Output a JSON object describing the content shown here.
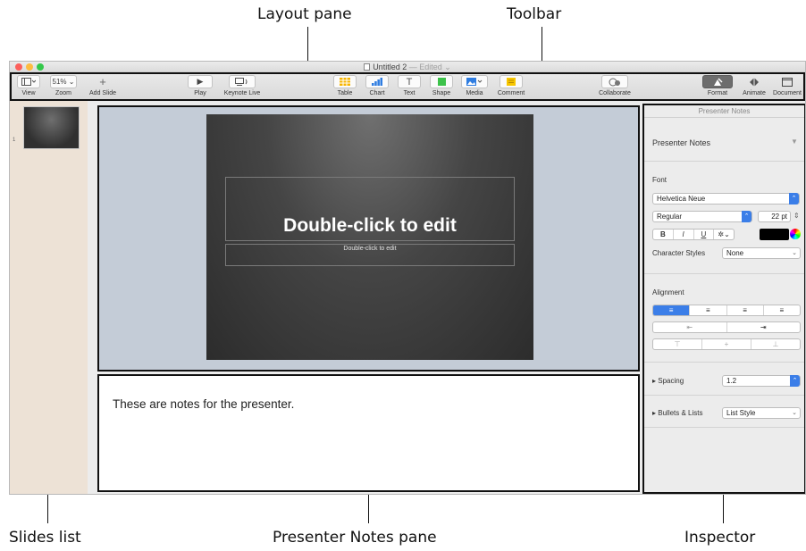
{
  "callouts": {
    "layout_pane": "Layout pane",
    "toolbar": "Toolbar",
    "slides_list": "Slides list",
    "presenter_notes_pane": "Presenter Notes pane",
    "inspector": "Inspector"
  },
  "window": {
    "title": "Untitled 2",
    "edited": "— Edited ⌄"
  },
  "toolbar": {
    "view": {
      "label": "View",
      "icon": "sidebar-view-icon"
    },
    "zoom": {
      "label": "Zoom",
      "value": "51% ⌄"
    },
    "add_slide": {
      "label": "Add Slide",
      "icon": "plus-icon"
    },
    "play": {
      "label": "Play",
      "icon": "play-icon"
    },
    "keynote_live": {
      "label": "Keynote Live",
      "icon": "keynote-live-icon"
    },
    "table": {
      "label": "Table",
      "icon": "table-icon"
    },
    "chart": {
      "label": "Chart",
      "icon": "chart-icon"
    },
    "text": {
      "label": "Text",
      "icon": "text-icon"
    },
    "shape": {
      "label": "Shape",
      "icon": "shape-icon"
    },
    "media": {
      "label": "Media",
      "icon": "media-icon"
    },
    "comment": {
      "label": "Comment",
      "icon": "comment-icon"
    },
    "collaborate": {
      "label": "Collaborate",
      "icon": "collaborate-icon"
    },
    "format": {
      "label": "Format",
      "icon": "format-brush-icon"
    },
    "animate": {
      "label": "Animate",
      "icon": "animate-icon"
    },
    "document": {
      "label": "Document",
      "icon": "document-icon"
    }
  },
  "slides": [
    {
      "number": "1"
    }
  ],
  "slide": {
    "title": "Double-click to edit",
    "subtitle": "Double-click to edit"
  },
  "notes": {
    "text": "These are notes for the presenter."
  },
  "inspector": {
    "header": "Presenter Notes",
    "style_name": "Presenter Notes",
    "font_label": "Font",
    "font_family": "Helvetica Neue",
    "font_style": "Regular",
    "font_size": "22 pt",
    "bold": "B",
    "italic": "I",
    "underline": "U",
    "character_styles_label": "Character Styles",
    "character_styles_value": "None",
    "alignment_label": "Alignment",
    "spacing_label": "Spacing",
    "spacing_value": "1.2",
    "bullets_label": "Bullets & Lists",
    "bullets_value": "List Style",
    "text_color": "#000000",
    "accent": "#3b7ee8"
  }
}
